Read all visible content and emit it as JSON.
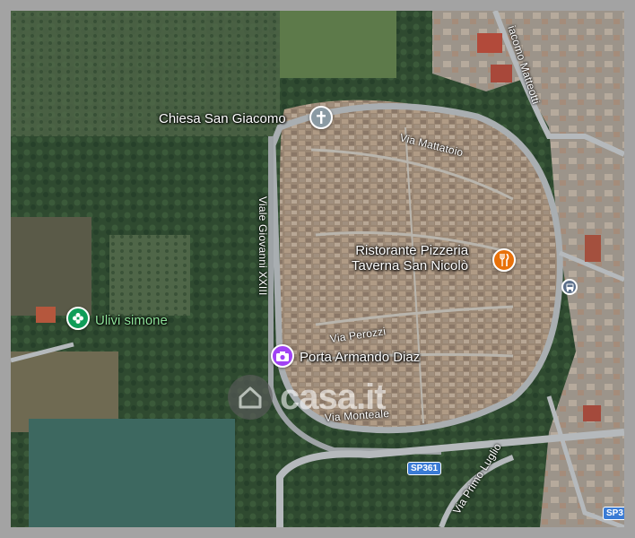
{
  "map": {
    "pois": [
      {
        "name": "Chiesa San Giacomo",
        "icon": "cross-icon",
        "color": "#8a9aa3"
      },
      {
        "name": "Ristorante Pizzeria\nTaverna San Nicolò",
        "icon": "fork-knife-icon",
        "color": "#e8710a"
      },
      {
        "name": "Ulivi simone",
        "icon": "flower-icon",
        "color": "#0f9d58"
      },
      {
        "name": "Porta Armando Diaz",
        "icon": "camera-icon",
        "color": "#a142f4"
      }
    ],
    "roads": [
      "Via Mattatoio",
      "Viale Giovanni XXIII",
      "Via Perozzi",
      "Via Monteale",
      "Via Primo Luglio",
      "iacomo Matteotti"
    ],
    "route_shields": [
      "SP361",
      "SP3"
    ],
    "watermark": "casa.it"
  }
}
